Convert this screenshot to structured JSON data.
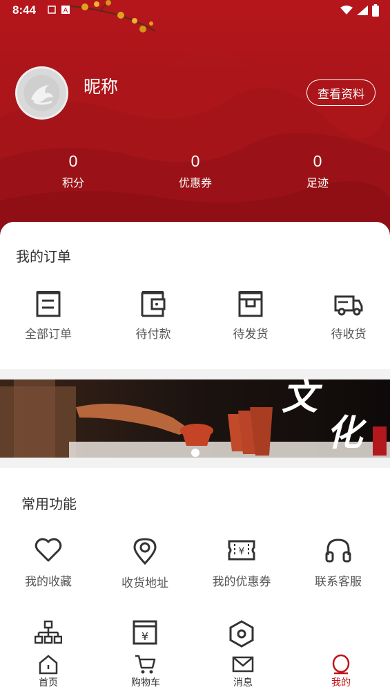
{
  "status_bar": {
    "time": "8:44"
  },
  "profile": {
    "nickname": "昵称",
    "view_profile_label": "查看资料"
  },
  "stats": [
    {
      "value": "0",
      "label": "积分"
    },
    {
      "value": "0",
      "label": "优惠券"
    },
    {
      "value": "0",
      "label": "足迹"
    }
  ],
  "orders": {
    "title": "我的订单",
    "items": [
      {
        "label": "全部订单",
        "icon": "all-orders-icon"
      },
      {
        "label": "待付款",
        "icon": "wallet-icon"
      },
      {
        "label": "待发货",
        "icon": "box-icon"
      },
      {
        "label": "待收货",
        "icon": "truck-icon"
      }
    ]
  },
  "banner": {
    "text_line1": "文",
    "text_line2": "化",
    "slide_count": 1,
    "active_slide": 1
  },
  "functions": {
    "title": "常用功能",
    "items": [
      {
        "label": "我的收藏",
        "icon": "heart-icon"
      },
      {
        "label": "收货地址",
        "icon": "location-pin-icon"
      },
      {
        "label": "我的优惠券",
        "icon": "coupon-icon"
      },
      {
        "label": "联系客服",
        "icon": "headphones-icon"
      },
      {
        "label": "",
        "icon": "org-chart-icon"
      },
      {
        "label": "",
        "icon": "yen-cart-icon"
      },
      {
        "label": "",
        "icon": "hexagon-nut-icon"
      }
    ]
  },
  "bottom_nav": {
    "items": [
      {
        "label": "首页",
        "icon": "home-icon"
      },
      {
        "label": "购物车",
        "icon": "cart-icon"
      },
      {
        "label": "消息",
        "icon": "message-icon"
      },
      {
        "label": "我的",
        "icon": "profile-icon"
      }
    ],
    "active": "我的"
  },
  "colors": {
    "brand_red": "#b5161c",
    "active_nav": "#c0141b",
    "text_gray": "#555555"
  }
}
